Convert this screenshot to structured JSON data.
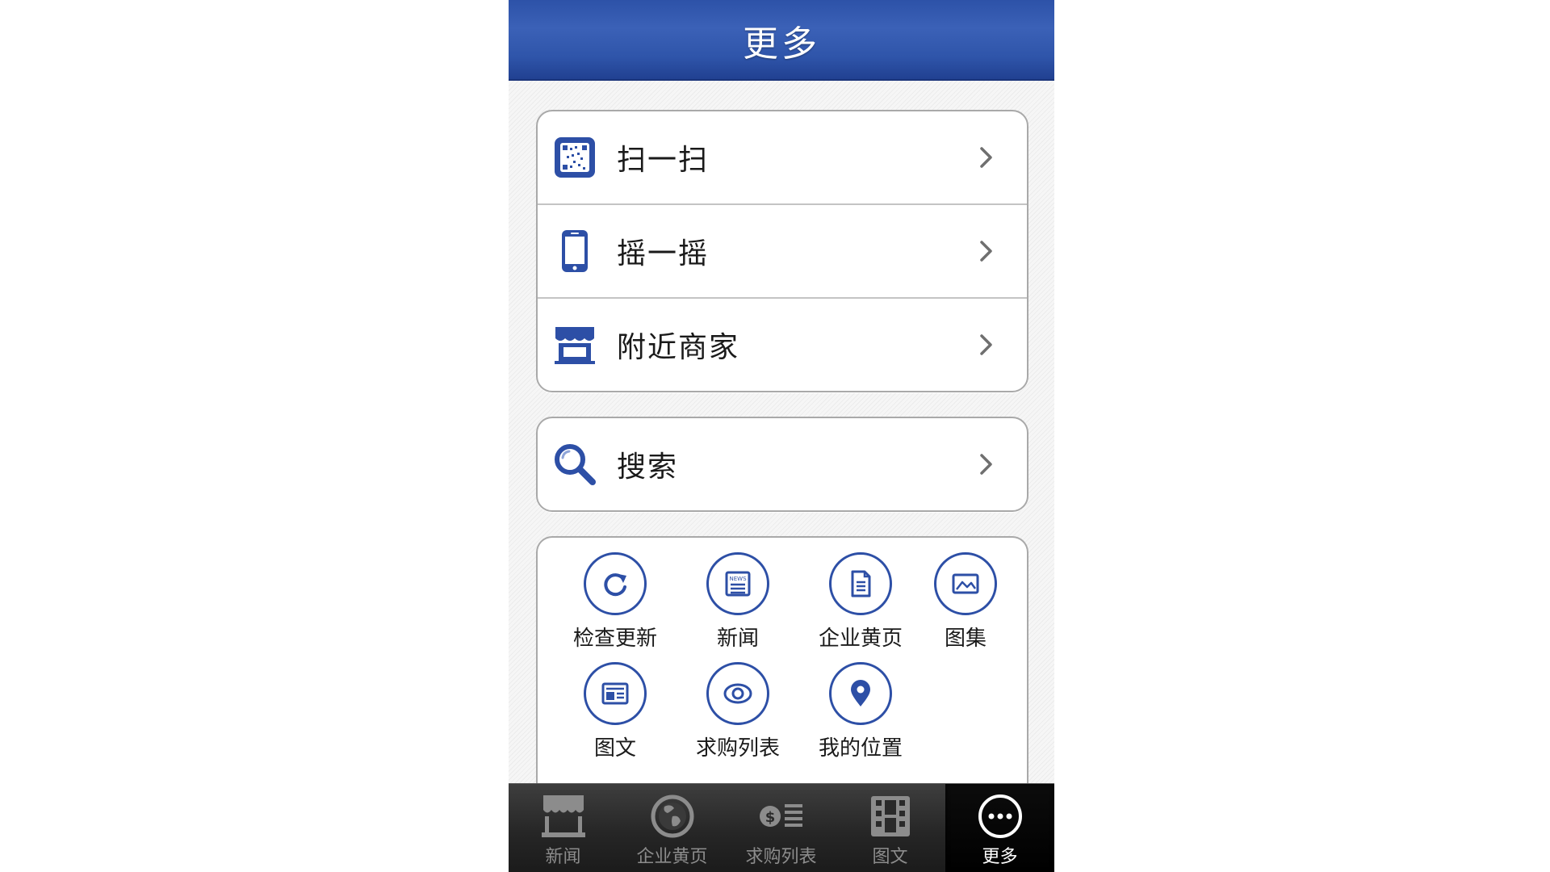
{
  "header": {
    "title": "更多"
  },
  "groups": {
    "tools": [
      {
        "label": "扫一扫",
        "icon": "qr-scan-icon"
      },
      {
        "label": "摇一摇",
        "icon": "phone-shake-icon"
      },
      {
        "label": "附近商家",
        "icon": "storefront-icon"
      }
    ],
    "search": {
      "label": "搜索",
      "icon": "search-icon"
    }
  },
  "grid": [
    {
      "label": "检查更新",
      "icon": "refresh-icon"
    },
    {
      "label": "新闻",
      "icon": "news-icon"
    },
    {
      "label": "企业黄页",
      "icon": "document-icon"
    },
    {
      "label": "图集",
      "icon": "image-icon"
    },
    {
      "label": "图文",
      "icon": "article-icon"
    },
    {
      "label": "求购列表",
      "icon": "eye-icon"
    },
    {
      "label": "我的位置",
      "icon": "location-pin-icon"
    }
  ],
  "tabbar": [
    {
      "label": "新闻",
      "icon": "store-awning-icon",
      "active": false
    },
    {
      "label": "企业黄页",
      "icon": "globe-icon",
      "active": false
    },
    {
      "label": "求购列表",
      "icon": "coin-list-icon",
      "active": false
    },
    {
      "label": "图文",
      "icon": "film-grid-icon",
      "active": false
    },
    {
      "label": "更多",
      "icon": "more-dots-icon",
      "active": true
    }
  ],
  "colors": {
    "brand_blue": "#2d4fa6",
    "header_blue": "#3b61b7",
    "tabbar_dark": "#262626",
    "tab_label": "#8c8c8c"
  }
}
